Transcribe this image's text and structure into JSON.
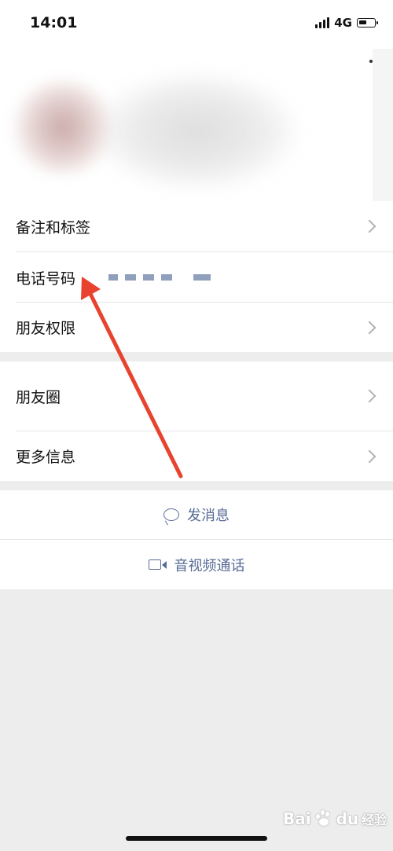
{
  "status_bar": {
    "time": "14:01",
    "network": "4G"
  },
  "rows": {
    "remarks_tags": "备注和标签",
    "phone": "电话号码",
    "permissions": "朋友权限",
    "moments": "朋友圈",
    "more_info": "更多信息"
  },
  "actions": {
    "send_message": "发消息",
    "av_call": "音视频通话"
  },
  "watermark": {
    "brand": "Bai",
    "brand_suffix": "du",
    "sub": "经验"
  },
  "colors": {
    "link": "#576b95",
    "arrow": "#e8432e",
    "background": "#ededed"
  },
  "icons": [
    "chevron-right-icon",
    "chat-bubble-icon",
    "video-camera-icon",
    "paw-icon",
    "signal-icon",
    "battery-icon"
  ]
}
